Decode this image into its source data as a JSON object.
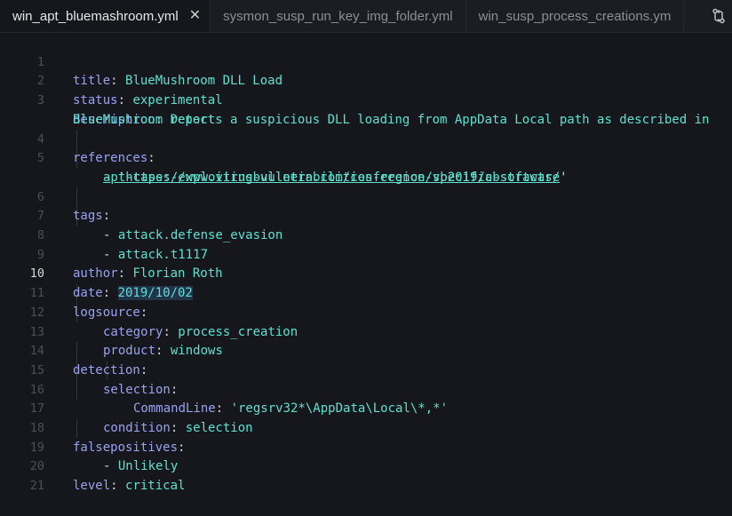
{
  "tabs": [
    {
      "label": "win_apt_bluemashroom.yml",
      "active": true,
      "close": "✕"
    },
    {
      "label": "sysmon_susp_run_key_img_folder.yml",
      "active": false
    },
    {
      "label": "win_susp_process_creations.ym",
      "active": false
    }
  ],
  "tab_actions": {
    "icon": "compare-changes-icon"
  },
  "editor": {
    "current_line": "10",
    "line_numbers": [
      "1",
      "2",
      "3",
      "4",
      "5",
      "6",
      "7",
      "8",
      "9",
      "10",
      "11",
      "12",
      "13",
      "14",
      "15",
      "16",
      "17",
      "18",
      "19",
      "20",
      "21"
    ],
    "lines": {
      "title": {
        "key": "title",
        "value": "BlueMushroom DLL Load"
      },
      "status": {
        "key": "status",
        "value": "experimental"
      },
      "description": {
        "key": "description",
        "value": "Detects a suspicious DLL loading from AppData Local path as described in",
        "continuation": "BlueMushroom report"
      },
      "references": {
        "key": "references",
        "dash": "- ",
        "quote_open": "'",
        "url_part1": "https://www.virusbulletin.com/conference/vb2019/abstracts/",
        "url_part2": "apt-cases-exploiting-vulnerabilities-region-specific-software",
        "quote_close": "'"
      },
      "tags": {
        "key": "tags",
        "items": [
          "attack.defense_evasion",
          "attack.t1117"
        ]
      },
      "author": {
        "key": "author",
        "value": "Florian Roth"
      },
      "date": {
        "key": "date",
        "value": "2019/10/02"
      },
      "logsource": {
        "key": "logsource",
        "category_key": "category",
        "category": "process_creation",
        "product_key": "product",
        "product": "windows"
      },
      "detection": {
        "key": "detection",
        "selection_key": "selection",
        "cmd_key": "CommandLine",
        "cmd_value": "'regsrv32*\\AppData\\Local\\*,*'",
        "condition_key": "condition",
        "condition": "selection"
      },
      "falsepositives": {
        "key": "falsepositives",
        "item": "Unlikely"
      },
      "level": {
        "key": "level",
        "value": "critical"
      }
    }
  },
  "colors": {
    "background": "#15171c",
    "key": "#9aa2ef",
    "value": "#5fe0cf",
    "text": "#d7d7d7",
    "line_number": "#4b4f57"
  }
}
